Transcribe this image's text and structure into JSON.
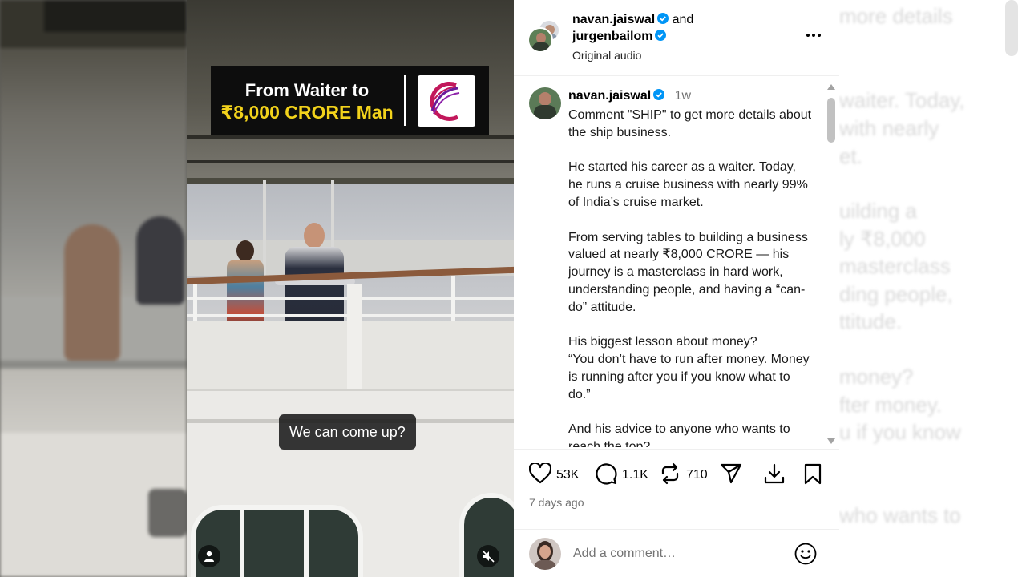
{
  "post": {
    "author1": "navan.jaiswal",
    "connector": "and",
    "author2": "jurgenbailom",
    "audio": "Original audio"
  },
  "comment": {
    "author": "navan.jaiswal",
    "age": "1w",
    "text": "Comment \"SHIP\" to get more details about the ship business.\n\nHe started his career as a waiter. Today, he runs a cruise business with nearly 99% of India’s cruise market.\n\nFrom serving tables to building a business valued at nearly ₹8,000 CRORE — his journey is a masterclass in hard work, understanding people, and having a “can-do” attitude.\n\nHis biggest lesson about money?\n“You don’t have to run after money. Money is running after you if you know what to do.”\n\nAnd his advice to anyone who wants to reach the top?"
  },
  "video": {
    "title_line1": "From Waiter to",
    "title_line2": "₹8,000 CRORE Man",
    "subtitle": "We can come up?"
  },
  "actions": {
    "likes": "53K",
    "comments": "1.1K",
    "reposts": "710",
    "posted": "7 days ago"
  },
  "add_comment": {
    "placeholder": "Add a comment…"
  },
  "backdrop_text": [
    "more details",
    "waiter. Today,",
    "with nearly",
    "et.",
    "uilding a",
    "ly ₹8,000",
    "masterclass",
    "ding people,",
    "ttitude.",
    "money?",
    "fter money.",
    "u if you know",
    "who wants to"
  ],
  "colors": {
    "verified": "#0095f6",
    "title_highlight": "#f2d21b"
  },
  "icons": [
    "verified-icon",
    "more-icon",
    "heart-icon",
    "comment-icon",
    "repost-icon",
    "share-icon",
    "download-icon",
    "bookmark-icon",
    "emoji-icon",
    "user-icon",
    "mute-icon",
    "scroll-up-icon",
    "scroll-down-icon"
  ]
}
